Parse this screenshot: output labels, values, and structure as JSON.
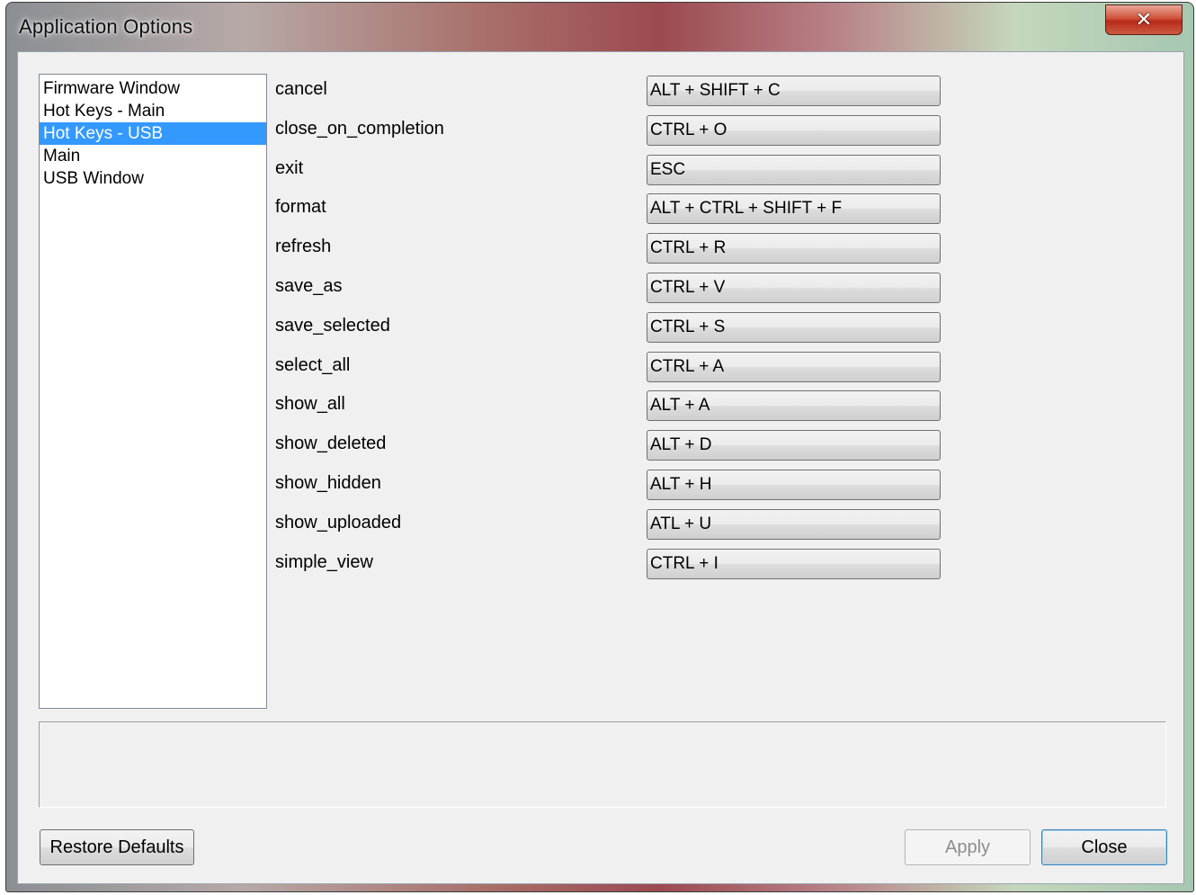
{
  "window": {
    "title": "Application Options",
    "close_glyph": "✕"
  },
  "categories": {
    "items": [
      {
        "label": "Firmware Window",
        "selected": false
      },
      {
        "label": "Hot Keys - Main",
        "selected": false
      },
      {
        "label": "Hot Keys - USB",
        "selected": true
      },
      {
        "label": "Main",
        "selected": false
      },
      {
        "label": "USB Window",
        "selected": false
      }
    ]
  },
  "hotkeys": [
    {
      "name": "cancel",
      "shortcut": "ALT + SHIFT + C"
    },
    {
      "name": "close_on_completion",
      "shortcut": "CTRL + O"
    },
    {
      "name": "exit",
      "shortcut": "ESC"
    },
    {
      "name": "format",
      "shortcut": "ALT + CTRL + SHIFT + F"
    },
    {
      "name": "refresh",
      "shortcut": "CTRL + R"
    },
    {
      "name": "save_as",
      "shortcut": "CTRL + V"
    },
    {
      "name": "save_selected",
      "shortcut": "CTRL + S"
    },
    {
      "name": "select_all",
      "shortcut": "CTRL + A"
    },
    {
      "name": "show_all",
      "shortcut": "ALT + A"
    },
    {
      "name": "show_deleted",
      "shortcut": "ALT + D"
    },
    {
      "name": "show_hidden",
      "shortcut": "ALT + H"
    },
    {
      "name": "show_uploaded",
      "shortcut": "ATL + U"
    },
    {
      "name": "simple_view",
      "shortcut": "CTRL + I"
    }
  ],
  "buttons": {
    "restore_defaults": "Restore Defaults",
    "apply": "Apply",
    "close": "Close"
  }
}
